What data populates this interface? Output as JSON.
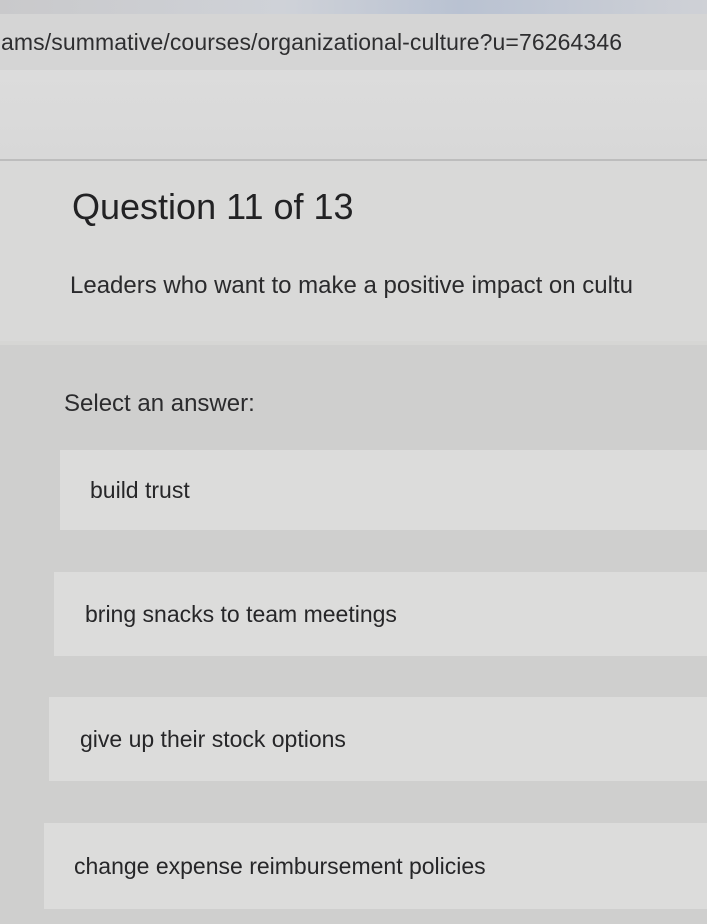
{
  "browser": {
    "url": "ams/summative/courses/organizational-culture?u=76264346"
  },
  "quiz": {
    "title": "Question 11 of 13",
    "question": "Leaders who want to make a positive impact on cultu",
    "select_label": "Select an answer:",
    "options": [
      {
        "label": "build trust"
      },
      {
        "label": "bring snacks to team meetings"
      },
      {
        "label": "give up their stock options"
      },
      {
        "label": "change expense reimbursement policies"
      }
    ]
  }
}
